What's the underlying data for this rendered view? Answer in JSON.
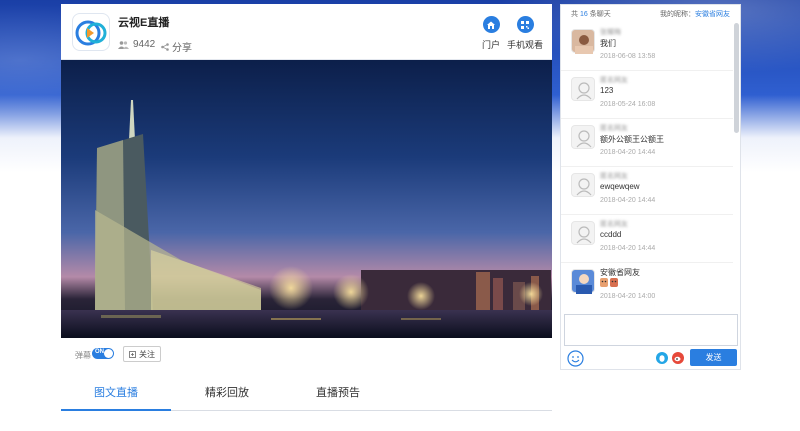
{
  "header": {
    "title": "云视E直播",
    "viewer_count": "9442",
    "share_label": "分享",
    "portal_label": "门户",
    "mobile_label": "手机观看"
  },
  "controls": {
    "danmu_label": "弹幕",
    "toggle_state": "ON",
    "follow_label": "关注"
  },
  "tabs": [
    {
      "label": "图文直播",
      "active": true
    },
    {
      "label": "精彩回放",
      "active": false
    },
    {
      "label": "直播预告",
      "active": false
    }
  ],
  "chat": {
    "count_prefix": "共",
    "count": "16",
    "count_suffix": "条聊天",
    "nick_prefix": "我的昵称：",
    "nick": "安徽省网友",
    "messages": [
      {
        "name": "张耀梅",
        "text": "我们",
        "time": "2018-06-08 13:58"
      },
      {
        "name": "匿名网友",
        "text": "123",
        "time": "2018-05-24 16:08"
      },
      {
        "name": "匿名网友",
        "text": "额外公额王公额王",
        "time": "2018-04-20 14:44"
      },
      {
        "name": "匿名网友",
        "text": "ewqewqew",
        "time": "2018-04-20 14:44"
      },
      {
        "name": "匿名网友",
        "text": "ccddd",
        "time": "2018-04-20 14:44"
      },
      {
        "name": "安徽省网友",
        "text": "",
        "time": "2018-04-20 14:00"
      }
    ],
    "input_placeholder": "",
    "send_label": "发送"
  },
  "colors": {
    "accent": "#2a7ee0",
    "banner": "#1a3fa6"
  },
  "icons": {
    "viewers": "users-icon",
    "share": "share-icon",
    "portal": "home-icon",
    "mobile": "qrcode-icon",
    "emoji": "smiley-icon",
    "qq": "qq-icon",
    "weibo": "weibo-icon"
  }
}
